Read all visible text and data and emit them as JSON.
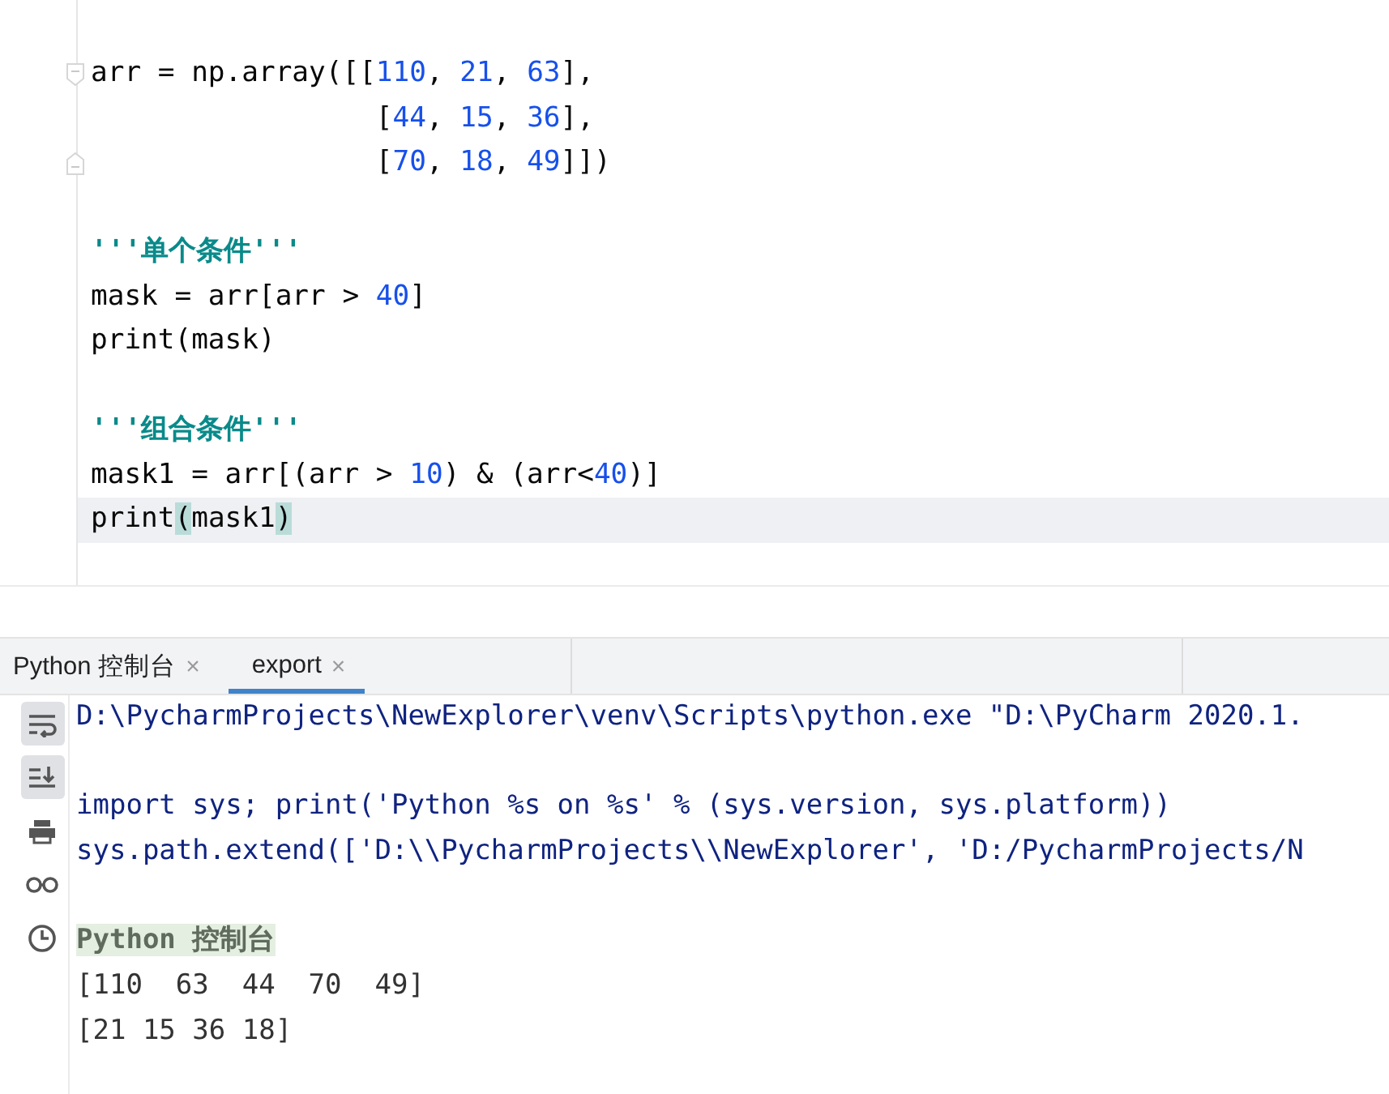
{
  "editor": {
    "lines": [
      {
        "kind": "fold-start",
        "current": false,
        "tokens": [
          {
            "kind": "plain",
            "text": "arr = np.array([["
          },
          {
            "kind": "number",
            "text": "110"
          },
          {
            "kind": "plain",
            "text": ", "
          },
          {
            "kind": "number",
            "text": "21"
          },
          {
            "kind": "plain",
            "text": ", "
          },
          {
            "kind": "number",
            "text": "63"
          },
          {
            "kind": "plain",
            "text": "],"
          }
        ]
      },
      {
        "kind": "code",
        "current": false,
        "tokens": [
          {
            "kind": "plain",
            "text": "                 ["
          },
          {
            "kind": "number",
            "text": "44"
          },
          {
            "kind": "plain",
            "text": ", "
          },
          {
            "kind": "number",
            "text": "15"
          },
          {
            "kind": "plain",
            "text": ", "
          },
          {
            "kind": "number",
            "text": "36"
          },
          {
            "kind": "plain",
            "text": "],"
          }
        ]
      },
      {
        "kind": "fold-end",
        "current": false,
        "tokens": [
          {
            "kind": "plain",
            "text": "                 ["
          },
          {
            "kind": "number",
            "text": "70"
          },
          {
            "kind": "plain",
            "text": ", "
          },
          {
            "kind": "number",
            "text": "18"
          },
          {
            "kind": "plain",
            "text": ", "
          },
          {
            "kind": "number",
            "text": "49"
          },
          {
            "kind": "plain",
            "text": "]])"
          }
        ]
      },
      {
        "kind": "blank"
      },
      {
        "kind": "code",
        "current": false,
        "tokens": [
          {
            "kind": "string",
            "text": "'''单个条件'''"
          }
        ]
      },
      {
        "kind": "code",
        "current": false,
        "tokens": [
          {
            "kind": "plain",
            "text": "mask = arr[arr > "
          },
          {
            "kind": "number",
            "text": "40"
          },
          {
            "kind": "plain",
            "text": "]"
          }
        ]
      },
      {
        "kind": "code",
        "current": false,
        "tokens": [
          {
            "kind": "plain",
            "text": "print(mask)"
          }
        ]
      },
      {
        "kind": "blank"
      },
      {
        "kind": "code",
        "current": false,
        "tokens": [
          {
            "kind": "string",
            "text": "'''组合条件'''"
          }
        ]
      },
      {
        "kind": "code",
        "current": false,
        "tokens": [
          {
            "kind": "plain",
            "text": "mask1 = arr[(arr > "
          },
          {
            "kind": "number",
            "text": "10"
          },
          {
            "kind": "plain",
            "text": ") & (arr<"
          },
          {
            "kind": "number",
            "text": "40"
          },
          {
            "kind": "plain",
            "text": ")]"
          }
        ]
      },
      {
        "kind": "code",
        "current": true,
        "tokens": [
          {
            "kind": "plain",
            "text": "print"
          },
          {
            "kind": "match",
            "text": "("
          },
          {
            "kind": "plain",
            "text": "mask1"
          },
          {
            "kind": "match",
            "text": ")"
          }
        ]
      }
    ]
  },
  "console": {
    "tabs": [
      {
        "label": "Python 控制台",
        "close": "×",
        "selected": false
      },
      {
        "label": "export",
        "close": "×",
        "selected": true
      }
    ],
    "tools": [
      {
        "kind": "wrap",
        "active": true
      },
      {
        "kind": "scroll-end",
        "active": true
      },
      {
        "kind": "print",
        "active": false
      },
      {
        "kind": "glasses",
        "active": false
      },
      {
        "kind": "clock",
        "active": false
      }
    ],
    "lines": [
      {
        "kind": "command",
        "text": "D:\\PycharmProjects\\NewExplorer\\venv\\Scripts\\python.exe \"D:\\PyCharm 2020.1."
      },
      {
        "kind": "blank"
      },
      {
        "kind": "command",
        "text": "import sys; print('Python %s on %s' % (sys.version, sys.platform))"
      },
      {
        "kind": "command",
        "text": "sys.path.extend(['D:\\\\PycharmProjects\\\\NewExplorer', 'D:/PycharmProjects/N"
      },
      {
        "kind": "blank"
      },
      {
        "kind": "header",
        "text": "Python 控制台"
      },
      {
        "kind": "output",
        "text": "[110  63  44  70  49]"
      },
      {
        "kind": "output",
        "text": "[21 15 36 18]"
      }
    ]
  }
}
